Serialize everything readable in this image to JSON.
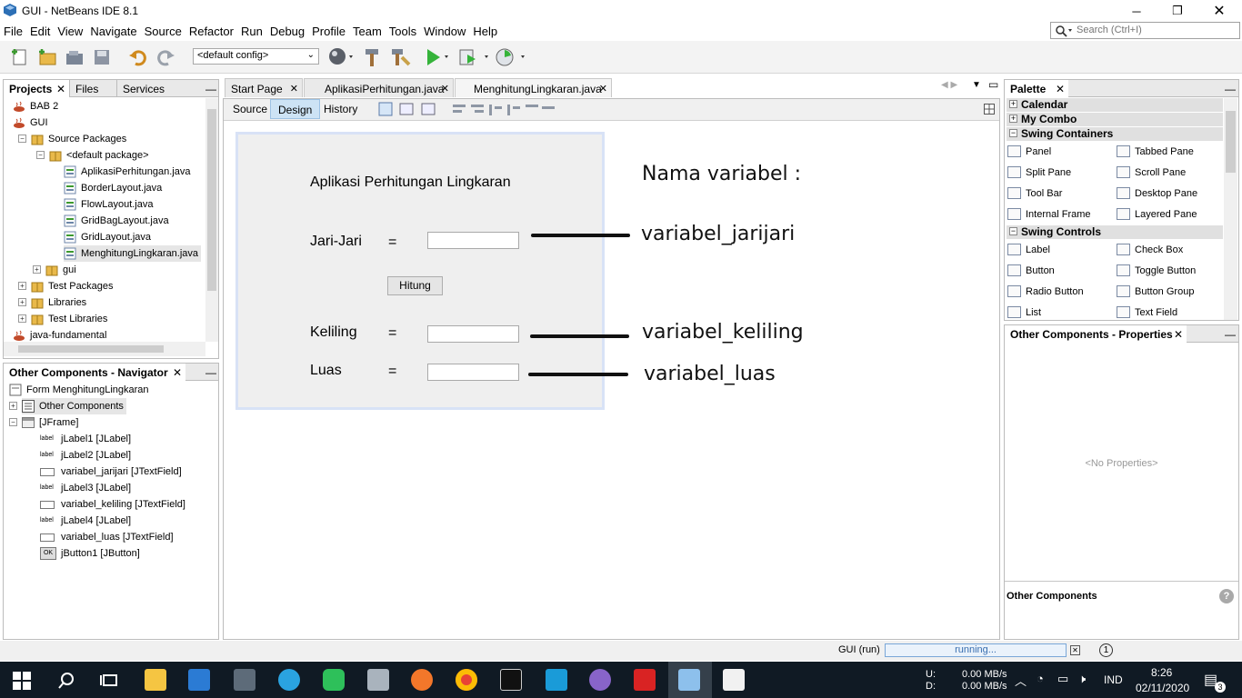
{
  "window": {
    "title": "GUI - NetBeans IDE 8.1"
  },
  "menu": [
    "File",
    "Edit",
    "View",
    "Navigate",
    "Source",
    "Refactor",
    "Run",
    "Debug",
    "Profile",
    "Team",
    "Tools",
    "Window",
    "Help"
  ],
  "search": {
    "placeholder": "Search (Ctrl+I)"
  },
  "toolbar": {
    "config": "<default config>"
  },
  "projects_panel": {
    "tabs": [
      "Projects",
      "Files",
      "Services"
    ],
    "tree": [
      {
        "label": "BAB 2"
      },
      {
        "label": "GUI"
      },
      {
        "label": "Source Packages"
      },
      {
        "label": "<default package>"
      },
      {
        "label": "AplikasiPerhitungan.java"
      },
      {
        "label": "BorderLayout.java"
      },
      {
        "label": "FlowLayout.java"
      },
      {
        "label": "GridBagLayout.java"
      },
      {
        "label": "GridLayout.java"
      },
      {
        "label": "MenghitungLingkaran.java"
      },
      {
        "label": "gui"
      },
      {
        "label": "Test Packages"
      },
      {
        "label": "Libraries"
      },
      {
        "label": "Test Libraries"
      },
      {
        "label": "java-fundamental"
      }
    ]
  },
  "navigator": {
    "title": "Other Components - Navigator",
    "items": [
      {
        "label": "Form MenghitungLingkaran"
      },
      {
        "label": "Other Components"
      },
      {
        "label": "[JFrame]"
      },
      {
        "label": "jLabel1 [JLabel]"
      },
      {
        "label": "jLabel2 [JLabel]"
      },
      {
        "label": "variabel_jarijari [JTextField]"
      },
      {
        "label": "jLabel3 [JLabel]"
      },
      {
        "label": "variabel_keliling [JTextField]"
      },
      {
        "label": "jLabel4 [JLabel]"
      },
      {
        "label": "variabel_luas [JTextField]"
      },
      {
        "label": "jButton1 [JButton]"
      }
    ],
    "icon_label": "label",
    "icon_ok": "OK"
  },
  "editor": {
    "tabs": [
      "Start Page",
      "AplikasiPerhitungan.java",
      "MenghitungLingkaran.java"
    ],
    "subtabs": [
      "Source",
      "Design",
      "History"
    ]
  },
  "form": {
    "title": "Aplikasi Perhitungan Lingkaran",
    "jari_label": "Jari-Jari",
    "keliling_label": "Keliling",
    "luas_label": "Luas",
    "eq": "=",
    "button": "Hitung"
  },
  "annotations": {
    "heading": "Nama variabel :",
    "jari": "variabel_jarijari",
    "keliling": "variabel_keliling",
    "luas": "variabel_luas"
  },
  "palette": {
    "title": "Palette",
    "categories": [
      "Calendar",
      "My Combo",
      "Swing Containers",
      "Swing Controls"
    ],
    "containers": [
      "Panel",
      "Tabbed Pane",
      "Split Pane",
      "Scroll Pane",
      "Tool Bar",
      "Desktop Pane",
      "Internal Frame",
      "Layered Pane"
    ],
    "controls": [
      "Label",
      "Check Box",
      "Button",
      "Toggle Button",
      "Radio Button",
      "Button Group",
      "List",
      "Text Field"
    ]
  },
  "properties": {
    "title": "Other Components - Properties",
    "empty": "<No Properties>",
    "footer": "Other Components",
    "help": "?"
  },
  "status": {
    "run": "GUI (run)",
    "progress": "running...",
    "badge": "1"
  },
  "tray": {
    "up": "U:",
    "down": "D:",
    "up_speed": "0.00 MB/s",
    "down_speed": "0.00 MB/s",
    "lang": "IND",
    "time": "8:26",
    "date": "02/11/2020",
    "notif": "3"
  }
}
